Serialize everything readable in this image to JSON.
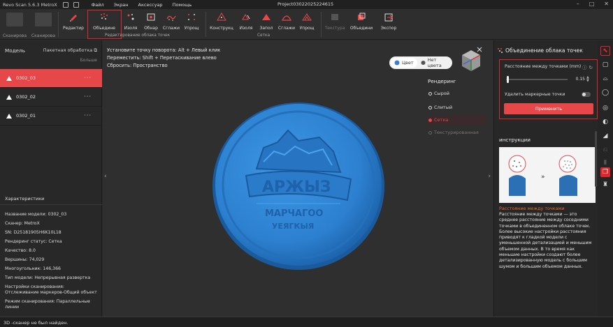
{
  "titlebar": {
    "app_title": "Revo Scan 5.6.3 MetroX",
    "menu": [
      "Файл",
      "Экран",
      "Аксессуар",
      "Помощь"
    ],
    "project": "Project03022025224615"
  },
  "toolbar": {
    "scan_tools": [
      {
        "label": "Сканирова"
      },
      {
        "label": "Сканирова"
      }
    ],
    "tools": [
      {
        "label": "Редактир",
        "icon": "edit-icon"
      },
      {
        "label": "Объедине",
        "icon": "merge-points-icon",
        "selected": true
      },
      {
        "label": "Изоля",
        "icon": "isolation-icon"
      },
      {
        "label": "Обнар",
        "icon": "detect-icon"
      },
      {
        "label": "Сглажи",
        "icon": "smooth-icon"
      },
      {
        "label": "Упрощ",
        "icon": "simplify-icon"
      },
      {
        "label": "Конструкц",
        "icon": "construct-icon"
      },
      {
        "label": "Изоля",
        "icon": "isolation-icon"
      },
      {
        "label": "Запол",
        "icon": "fill-icon"
      },
      {
        "label": "Сглажи",
        "icon": "smooth-icon"
      },
      {
        "label": "Упрощ",
        "icon": "simplify-icon"
      },
      {
        "label": "Текстура",
        "icon": "texture-icon",
        "disabled": true
      },
      {
        "label": "Объедини",
        "icon": "combine-icon"
      },
      {
        "label": "Экспор",
        "icon": "export-icon"
      }
    ],
    "group_point_cloud": "Редактирование облака точек",
    "group_mesh": "Сетка"
  },
  "left_panel": {
    "title": "Модель",
    "batch": "Пакетная обработка",
    "more": "Больше",
    "models": [
      {
        "name": "0302_03",
        "active": true
      },
      {
        "name": "0302_02",
        "active": false
      },
      {
        "name": "0302_01",
        "active": false
      }
    ],
    "props_title": "Характеристики",
    "props": [
      "Название модели:  0302_03",
      "Сканер:  MetroX",
      "SN:  D25181905H6K10L18",
      "Рендеринг статус:  Сетка",
      "Качество:  8.0",
      "Вершины:  74,029",
      "Многоугольник:  146,366",
      "Тип модели:  Непрерывная развертка",
      "Настройки сканирования:",
      "Отслеживание маркеров-Общий объект",
      "Режим сканирования:  Параллельные",
      "линии"
    ]
  },
  "viewport": {
    "hints": [
      "Установите точку поворота: Alt + Левый клик",
      "Переместить: Shift + Перетаскивание влево",
      "Сбросить: Пространство"
    ],
    "color_on": "Цвет",
    "color_off": "Нет цвета",
    "render_title": "Рендеринг",
    "render_options": [
      {
        "label": "Сырой",
        "state": "normal"
      },
      {
        "label": "Слитый",
        "state": "normal"
      },
      {
        "label": "Сетка",
        "state": "selected"
      },
      {
        "label": "Текстурированная",
        "state": "disabled"
      }
    ],
    "coin_color": "#2f86d6"
  },
  "right_panel": {
    "title": "Объединение облака точек",
    "distance_label": "Расстояние между точками (mm)",
    "distance_value": "0.15",
    "distance_fraction": 0.03,
    "marker_label": "Удалить маркерные точки",
    "marker_enabled": false,
    "apply": "Применить",
    "instructions_title": "инструкции",
    "instructions_heading": "Расстояние между точками",
    "instructions_text": "Расстояние между точками — это среднее расстояние между соседними точками в объединенном облаке точек. Более высокие настройки расстояния приводят к гладкой модели с уменьшенной детализацией и меньшим объемом данных. В то время как меньшие настройки создают более детализированную модель с большим шумом и большим объемом данных."
  },
  "status": {
    "text": "3D -сканер не был найден."
  },
  "colors": {
    "accent": "#e8474a",
    "highlight_border": "#e2242b",
    "instructions_heading": "#e86a2b"
  }
}
